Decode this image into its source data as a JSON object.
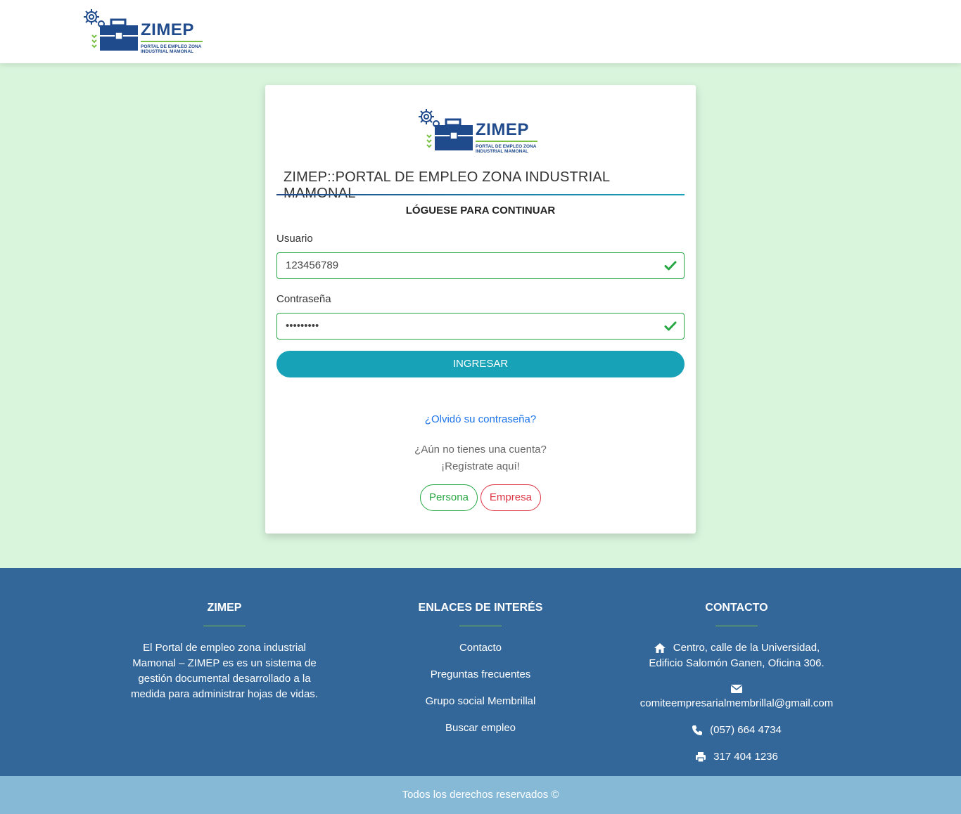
{
  "header": {
    "logo_name": "ZIMEP",
    "logo_subtitle": "PORTAL DE EMPLEO ZONA INDUSTRIAL MAMONAL"
  },
  "login": {
    "title": "ZIMEP::PORTAL DE EMPLEO ZONA INDUSTRIAL MAMONAL",
    "subtitle": "LÓGUESE PARA CONTINUAR",
    "user_label": "Usuario",
    "user_value": "123456789",
    "password_label": "Contraseña",
    "password_value": "123456789",
    "submit_label": "INGRESAR",
    "forgot_label": "¿Olvidó su contraseña?",
    "no_account_line1": "¿Aún no tienes una cuenta?",
    "no_account_line2": "¡Regístrate aquí!",
    "register_persona": "Persona",
    "register_empresa": "Empresa"
  },
  "footer": {
    "about": {
      "title": "ZIMEP",
      "text": "El Portal de empleo zona industrial Mamonal – ZIMEP es es un sistema de gestión documental desarrollado a la medida para administrar hojas de vidas."
    },
    "links": {
      "title": "ENLACES DE INTERÉS",
      "items": [
        "Contacto",
        "Preguntas frecuentes",
        "Grupo social Membrillal",
        "Buscar empleo"
      ]
    },
    "contact": {
      "title": "CONTACTO",
      "address_line1": "Centro, calle de la Universidad,",
      "address_line2": "Edificio Salomón Ganen, Oficina 306.",
      "email": "comiteempresarialmembrillal@gmail.com",
      "phone": "(057) 664 4734",
      "fax": "317 404 1236"
    },
    "copyright": "Todos los derechos reservados ©"
  },
  "colors": {
    "page_bg": "#d9f5dc",
    "accent": "#17a2b8",
    "footer_bg": "#336699",
    "bottom_bar_bg": "#85b9d6",
    "brand_blue": "#1f4a8c",
    "valid_green": "#28a745",
    "danger_red": "#dc3545"
  },
  "icons": [
    "gear-icon",
    "briefcase-icon",
    "check-icon",
    "home-icon",
    "envelope-icon",
    "phone-icon",
    "print-icon"
  ]
}
